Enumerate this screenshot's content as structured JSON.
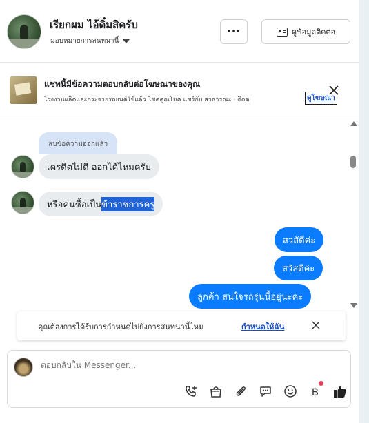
{
  "header": {
    "name": "เรียกผม ไอ้ดิ๋มสิครับ",
    "assign_label": "มอบหมายการสนทนานี้",
    "more_label": "···",
    "contact_button_label": "ดูข้อมูลติดต่อ"
  },
  "ad": {
    "title": "แชทนี้มีข้อความตอบกลับต่อโฆษณาของคุณ",
    "subtitle": "โรงงานผลิตและกระจายรถยนต์ใช้แล้ว โชคคูณโชค แชร์กับ สาธารณะ · ดิดต",
    "link_label": "ดูโฆษณา"
  },
  "messages": {
    "removed_label": "ลบข้อความออกแล้ว",
    "incoming": [
      {
        "text": "เครดิตไม่ดี ออกได้ไหมครับ"
      },
      {
        "text_plain": "หรือคนซื้อเป็น",
        "text_highlight": "ข้าราชการครู"
      }
    ],
    "outgoing": [
      {
        "text": "สวสัดีค่ะ"
      },
      {
        "text": "สวัสดีค่ะ"
      },
      {
        "text": "ลูกค้า  สนใจรถรุ่นนี้อยู่นะคะ"
      }
    ]
  },
  "reminder": {
    "text": "คุณต้องการได้รับการกำหนดไปยังการสนทนานี้ไหม",
    "link_label": "กำหนดให้ฉัน"
  },
  "composer": {
    "placeholder": "ตอบกลับใน Messenger...",
    "icons": [
      "call-add-icon",
      "shopping-bag-icon",
      "paperclip-icon",
      "chat-bubble-icon",
      "emoji-icon",
      "baht-icon",
      "thumbs-up-icon"
    ],
    "baht_symbol": "฿"
  },
  "colors": {
    "accent": "#0a7cff",
    "link": "#1b4fc2",
    "notification_dot": "#e4405f"
  }
}
